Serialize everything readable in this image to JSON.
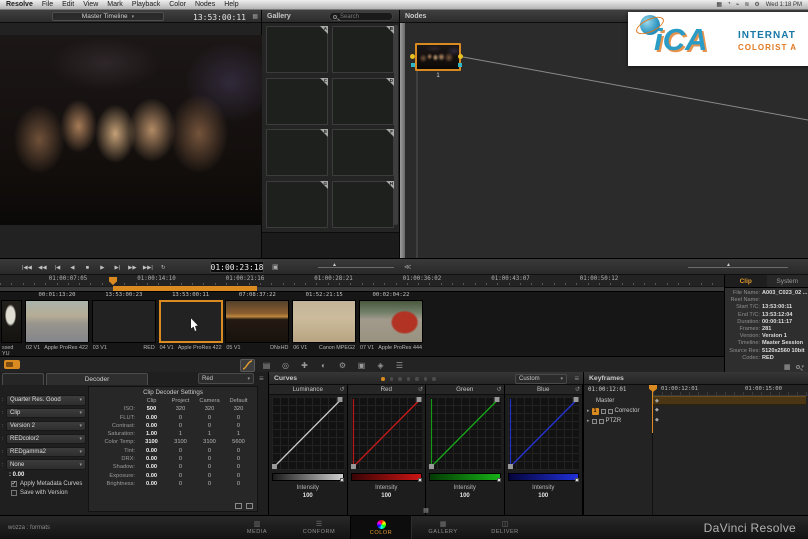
{
  "accent_color": "#d98a20",
  "menu_bar": {
    "app": "Resolve",
    "items": [
      "File",
      "Edit",
      "View",
      "Mark",
      "Playback",
      "Color",
      "Nodes",
      "Help"
    ],
    "status_icons": [
      "▦",
      "◔",
      "⌁",
      "≋",
      "⚙"
    ],
    "clock": "Wed 1:18 PM"
  },
  "logo": {
    "acronym": "iCA",
    "line1": "INTERNAT",
    "line2": "COLORIST A"
  },
  "viewer": {
    "timeline_selector": "Master Timeline",
    "timecode": "13:53:00:11"
  },
  "gallery": {
    "title": "Gallery",
    "search_placeholder": "Search",
    "slots": [
      "A",
      "B",
      "C",
      "D",
      "E",
      "F",
      "G",
      "H"
    ]
  },
  "nodes": {
    "title": "Nodes",
    "node_label": "1"
  },
  "transport": {
    "buttons": [
      {
        "name": "jump-start",
        "glyph": "|◀◀"
      },
      {
        "name": "rewind",
        "glyph": "◀◀"
      },
      {
        "name": "prev-frame",
        "glyph": "|◀"
      },
      {
        "name": "play-reverse",
        "glyph": "◀"
      },
      {
        "name": "stop",
        "glyph": "■"
      },
      {
        "name": "play",
        "glyph": "▶"
      },
      {
        "name": "next-frame",
        "glyph": "▶|"
      },
      {
        "name": "fast-forward",
        "glyph": "▶▶"
      },
      {
        "name": "jump-end",
        "glyph": "▶▶|"
      },
      {
        "name": "loop",
        "glyph": "↻"
      }
    ],
    "timecode": "01:00:23:18"
  },
  "timeline_ruler": {
    "labels": [
      "01:00:07:05",
      "01:00:14:10",
      "01:00:21:16",
      "01:00:28:21",
      "01:00:36:02",
      "01:00:43:07",
      "01:00:50:12"
    ]
  },
  "clip_info": {
    "tabs": [
      "Clip",
      "System"
    ],
    "active_tab": "Clip",
    "rows": [
      {
        "label": "File Name:",
        "value": "A003_C023_02 ..."
      },
      {
        "label": "Reel Name:",
        "value": ""
      },
      {
        "label": "Start T/C:",
        "value": "13:53:00:11"
      },
      {
        "label": "End T/C:",
        "value": "13:53:12:04"
      },
      {
        "label": "Duration:",
        "value": "00:00:11:17"
      },
      {
        "label": "Frames:",
        "value": "281"
      },
      {
        "label": "Version:",
        "value": "Version 1"
      },
      {
        "label": "Timeline:",
        "value": "Master Session"
      },
      {
        "label": "Source Res:",
        "value": "5120x2560 10bit"
      },
      {
        "label": "Codec:",
        "value": "RED"
      }
    ]
  },
  "filmstrip": {
    "partial": {
      "codec": "ssed YU",
      "scene": "sc-sail"
    },
    "clips": [
      {
        "num": "02 V1",
        "codec": "Apple ProRes 422",
        "tc": "00:01:13:20",
        "scene": "sc-street",
        "selected": false
      },
      {
        "num": "03 V1",
        "codec": "RED",
        "tc": "13:53:00:23",
        "scene": "party-scene",
        "selected": false
      },
      {
        "num": "04 V1",
        "codec": "Apple ProRes 422",
        "tc": "13:53:00:11",
        "scene": "party-scene",
        "selected": true
      },
      {
        "num": "05 V1",
        "codec": "DNxHD",
        "tc": "07:08:37:22",
        "scene": "sc-sunset",
        "selected": false
      },
      {
        "num": "06 V1",
        "codec": "Canon MPEG2",
        "tc": "01:52:21:15",
        "scene": "sc-beach",
        "selected": false
      },
      {
        "num": "07 V1",
        "codec": "Apple ProRes 444",
        "tc": "00:02:04:22",
        "scene": "sc-tram",
        "selected": false
      }
    ]
  },
  "tool_row": {
    "icons": [
      {
        "name": "custom-curves-icon",
        "glyph": "∿",
        "active": true
      },
      {
        "name": "primaries-icon",
        "glyph": "▤",
        "active": false
      },
      {
        "name": "qualifier-icon",
        "glyph": "◎",
        "active": false
      },
      {
        "name": "power-window-icon",
        "glyph": "✚",
        "active": false
      },
      {
        "name": "window-shape-icon",
        "glyph": "◐",
        "active": false
      },
      {
        "name": "gear-icon",
        "glyph": "⚙",
        "active": false
      },
      {
        "name": "sizing-icon",
        "glyph": "▣",
        "active": false
      },
      {
        "name": "tracker-icon",
        "glyph": "◈",
        "active": false
      },
      {
        "name": "blur-icon",
        "glyph": "☰",
        "active": false
      }
    ]
  },
  "decoder": {
    "tab_label": "Decoder",
    "channel_select": "Red",
    "dropdowns": [
      "Quarter Res. Good",
      "Clip",
      "Version 2",
      "REDcolor2",
      "REDgamma2",
      "None"
    ],
    "value_row": "0.00",
    "checkboxes": [
      {
        "label": "Apply Metadata Curves",
        "checked": true
      },
      {
        "label": "Save with Version",
        "checked": false
      }
    ]
  },
  "decoder_settings": {
    "title": "Clip Decoder Settings",
    "columns": [
      "Clip",
      "Project",
      "Camera",
      "Default"
    ],
    "rows": [
      {
        "label": "ISO:",
        "clip": "500",
        "project": "320",
        "camera": "320",
        "default": "320"
      },
      {
        "label": "FLUT:",
        "clip": "0.00",
        "project": "0",
        "camera": "0",
        "default": "0"
      },
      {
        "label": "Contrast:",
        "clip": "0.00",
        "project": "0",
        "camera": "0",
        "default": "0"
      },
      {
        "label": "Saturation:",
        "clip": "1.00",
        "project": "1",
        "camera": "1",
        "default": "1"
      },
      {
        "label": "Color Temp:",
        "clip": "3100",
        "project": "3100",
        "camera": "3100",
        "default": "5600"
      },
      {
        "label": "Tint:",
        "clip": "0.00",
        "project": "0",
        "camera": "0",
        "default": "0"
      },
      {
        "label": "DRX:",
        "clip": "0.00",
        "project": "0",
        "camera": "0",
        "default": "0"
      },
      {
        "label": "Shadow:",
        "clip": "0.00",
        "project": "0",
        "camera": "0",
        "default": "0"
      },
      {
        "label": "Exposure:",
        "clip": "0.00",
        "project": "0",
        "camera": "0",
        "default": "0"
      },
      {
        "label": "Brightness:",
        "clip": "0.00",
        "project": "0",
        "camera": "0",
        "default": "0"
      }
    ]
  },
  "curves": {
    "title": "Curves",
    "preset": "Custom",
    "dot_count": 7,
    "active_dot": 0,
    "panels": [
      {
        "name": "Luminance",
        "color": "#c8c8c8",
        "slider_from": "#1c1c1c",
        "slider_to": "#cfcfcf"
      },
      {
        "name": "Red",
        "color": "#cc1a1a",
        "slider_from": "#3a0404",
        "slider_to": "#cc1515"
      },
      {
        "name": "Green",
        "color": "#18aa18",
        "slider_from": "#043a04",
        "slider_to": "#16b216"
      },
      {
        "name": "Blue",
        "color": "#2434d8",
        "slider_from": "#04043a",
        "slider_to": "#2030d8"
      }
    ],
    "intensity_label": "Intensity",
    "intensity_value": "100"
  },
  "keyframes": {
    "title": "Keyframes",
    "position": "01:00:12:01",
    "ruler_labels": [
      "01:00:12:01",
      "01:00:15:00"
    ],
    "tracks": [
      {
        "label": "Master",
        "badge": "",
        "icons": false,
        "highlight": true
      },
      {
        "label": "Corrector",
        "badge": "1",
        "icons": true,
        "highlight": false
      },
      {
        "label": "PTZR",
        "badge": "",
        "icons": true,
        "highlight": false
      }
    ]
  },
  "footer": {
    "left_label": "wozza : formats",
    "pages": [
      {
        "label": "MEDIA",
        "icon": "▥"
      },
      {
        "label": "CONFORM",
        "icon": "☰"
      },
      {
        "label": "COLOR",
        "icon": "wheel"
      },
      {
        "label": "GALLERY",
        "icon": "▦"
      },
      {
        "label": "DELIVER",
        "icon": "◫"
      }
    ],
    "active_page": "COLOR",
    "brand": "DaVinci Resolve"
  }
}
